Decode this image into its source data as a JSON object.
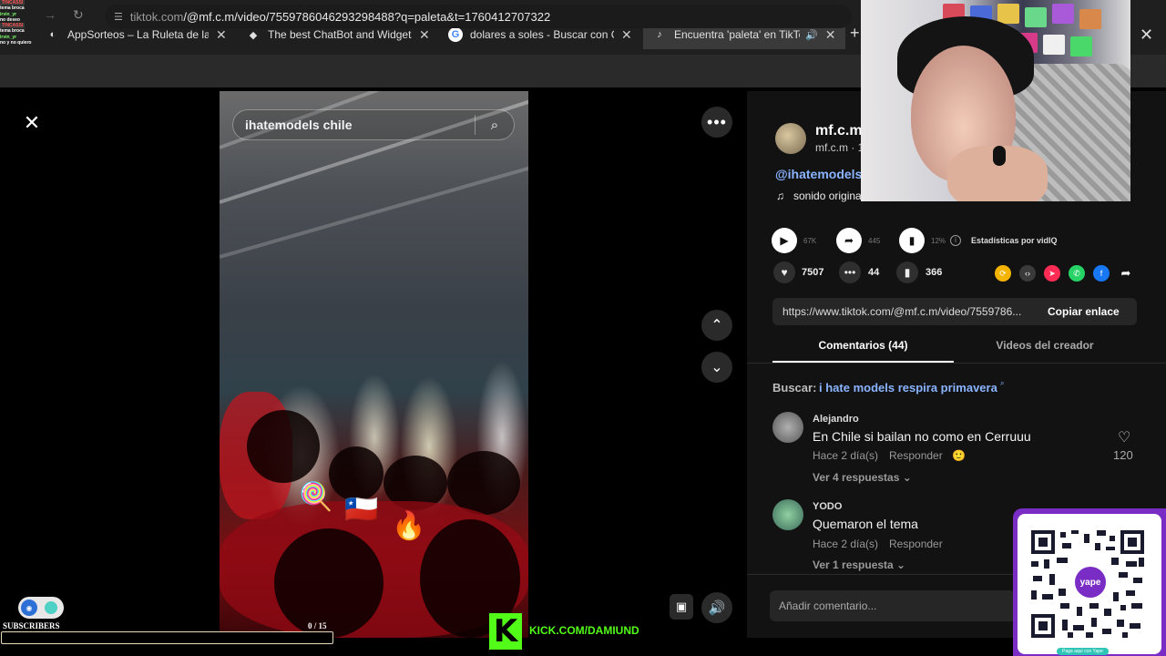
{
  "browser": {
    "tabs": [
      {
        "label": "AppSorteos – La Ruleta de la Su",
        "icon": "appsorteos-icon",
        "active": false
      },
      {
        "label": "The best ChatBot and Widgets",
        "icon": "streamelements-icon",
        "active": false
      },
      {
        "label": "dolares a soles - Buscar con Go",
        "icon": "google-icon",
        "active": false
      },
      {
        "label": "Encuentra 'paleta' en TikTok",
        "icon": "tiktok-icon",
        "active": true
      }
    ],
    "url_host": "tiktok.com",
    "url_path": "/@mf.c.m/video/7559786046293298488?q=paleta&t=1760412707322"
  },
  "chat_overlay": [
    {
      "user": "TINCASSI",
      "msg": "tema broca"
    },
    {
      "user": "irvin_yr",
      "msg": "no deseo"
    },
    {
      "user": "TINCASSI",
      "msg": "tema broca"
    },
    {
      "user": "irvin_yr",
      "msg": "no y no quiero"
    }
  ],
  "video": {
    "search_text": "ihatemodels chile",
    "emojis": [
      "🍭",
      "🇨🇱",
      "🔥"
    ]
  },
  "author": {
    "name": "mf.c.m",
    "sub": "mf.c.m · 1",
    "tag": "@ihatemodels",
    "sound": "sonido origina"
  },
  "stats": {
    "plays": "67K",
    "shares": "445",
    "percent": "12%",
    "vidiq_label": "Estadísticas por vidIQ"
  },
  "actions": {
    "likes": "7507",
    "comments": "44",
    "saves": "366"
  },
  "share_colors": [
    "#f5b400",
    "#3a3a3a",
    "#fe2c55",
    "#25d366",
    "#1877f2"
  ],
  "link": {
    "url": "https://www.tiktok.com/@mf.c.m/video/7559786...",
    "copy_label": "Copiar enlace"
  },
  "tabs": {
    "comments": "Comentarios (44)",
    "creator": "Videos del creador"
  },
  "search_suggestion": {
    "prefix": "Buscar:",
    "query": "i hate models respira primavera"
  },
  "comments": [
    {
      "name": "Alejandro",
      "text": "En Chile si bailan no como en Cerruuu",
      "time": "Hace 2 día(s)",
      "reply": "Responder",
      "more": "Ver 4 respuestas ⌄",
      "likes": "120"
    },
    {
      "name": "YODO",
      "text": "Quemaron el tema",
      "time": "Hace 2 día(s)",
      "reply": "Responder",
      "more": "Ver 1 respuesta ⌄"
    }
  ],
  "comment_input_placeholder": "Añadir comentario...",
  "subscribers": {
    "label": "SUBSCRIBERS",
    "count": "0  / 15",
    "progress": 0
  },
  "kick": {
    "logo": "K",
    "url": "KICK.COM/DAMIUND"
  },
  "qr": {
    "center_label": "yape",
    "caption": "Paga aquí con Yape"
  }
}
